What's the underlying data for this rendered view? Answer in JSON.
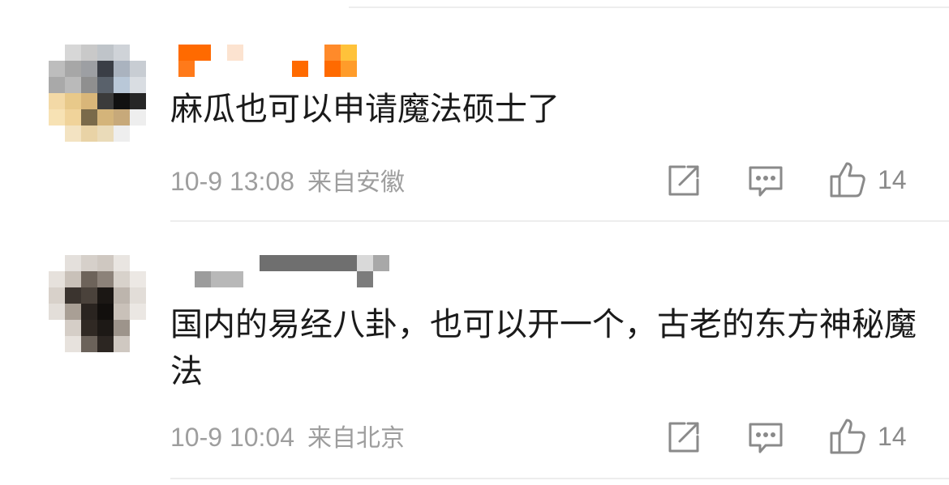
{
  "comments": [
    {
      "text": "麻瓜也可以申请魔法硕士了",
      "date": "10-9 13:08",
      "location": "来自安徽",
      "like_count": "14"
    },
    {
      "text": "国内的易经八卦，也可以开一个，古老的东方神秘魔法",
      "date": "10-9 10:04",
      "location": "来自北京",
      "like_count": "14"
    }
  ],
  "icons": {
    "share": "share-icon",
    "comment": "comment-icon",
    "like": "thumbs-up-icon"
  },
  "colors": {
    "text": "#1a1a1a",
    "meta": "#9e9e9e",
    "icon": "#8a8a8a",
    "divider": "#ededed",
    "username_1": "#ff6a00"
  }
}
